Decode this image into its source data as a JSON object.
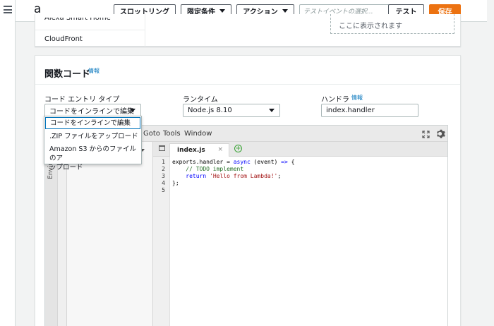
{
  "header": {
    "function_letter": "a",
    "buttons": {
      "throttling": "スロットリング",
      "qualifiers": "限定条件",
      "actions": "アクション",
      "test": "テスト",
      "save": "保存"
    },
    "test_event_placeholder": "テストイベントの選択..."
  },
  "designer": {
    "trigger_top": "Alexa Smart Home",
    "trigger_cloudfront": "CloudFront",
    "placeholder_text": "ここに表示されます"
  },
  "function_code": {
    "title": "関数コード",
    "info": "情報",
    "code_entry_label": "コード エントリ タイプ",
    "code_entry_value": "コードをインラインで編集",
    "runtime_label": "ランタイム",
    "runtime_value": "Node.js 8.10",
    "handler_label": "ハンドラ",
    "handler_info": "情報",
    "handler_value": "index.handler"
  },
  "dropdown": {
    "options": [
      "コードをインラインで編集",
      ".ZIP ファイルをアップロード",
      "Amazon S3 からのファイルのアップロード"
    ],
    "option3_line1": "Amazon S3 からのファイルのア",
    "option3_line2": "ップロード"
  },
  "editor": {
    "menus": [
      "Goto",
      "Tools",
      "Window"
    ],
    "env_label": "Envir",
    "tab_name": "index.js",
    "line_numbers": [
      "1",
      "2",
      "3",
      "4",
      "5"
    ],
    "code": {
      "l1_a": "exports.handler = ",
      "l1_kw": "async",
      "l1_b": " (event) ",
      "l1_arrow": "=>",
      "l1_c": " {",
      "l2": "    // TODO implement",
      "l3_a": "    ",
      "l3_kw": "return",
      "l3_b": " ",
      "l3_str": "'Hello from Lambda!'",
      "l3_c": ";",
      "l4": "};"
    }
  },
  "colors": {
    "accent": "#ec7211",
    "link": "#0073bb"
  }
}
